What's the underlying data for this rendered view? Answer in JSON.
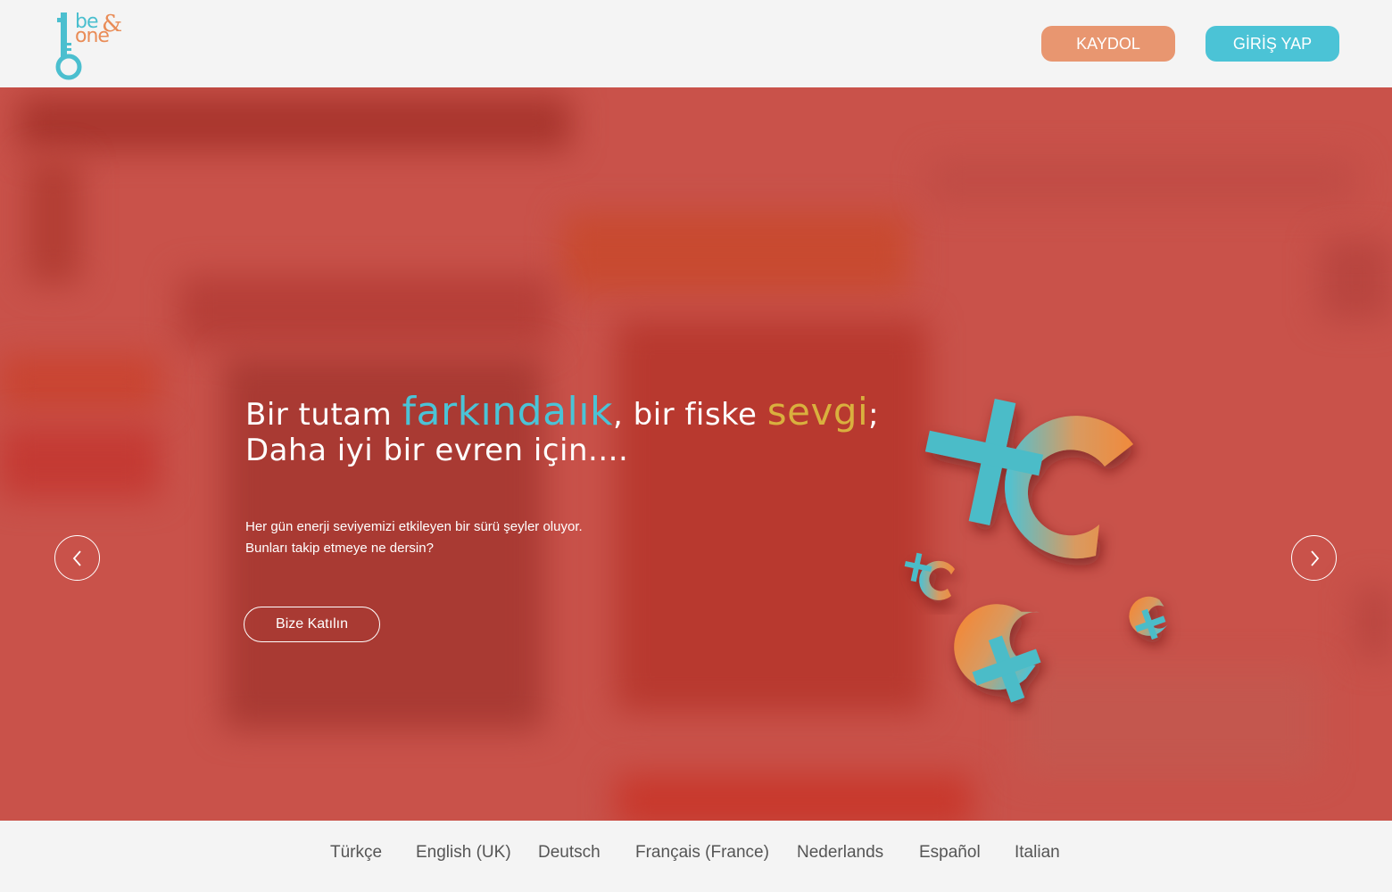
{
  "brand": {
    "logo_top": "be",
    "logo_bottom": "one",
    "logo_amp": "&"
  },
  "header": {
    "register_label": "KAYDOL",
    "login_label": "GİRİŞ YAP"
  },
  "hero": {
    "headline_part1": "Bir tutam ",
    "headline_awareness": "farkındalık",
    "headline_part2": ", bir fiske ",
    "headline_love": "sevgi",
    "headline_part3": ";",
    "headline_line2": "Daha iyi bir evren için....",
    "subtext_line1": "Her gün enerji seviyemizi etkileyen bir sürü şeyler oluyor.",
    "subtext_line2": "Bunları takip etmeye ne dersin?",
    "join_label": "Bize Katılın",
    "prev_icon": "chevron-left-icon",
    "next_icon": "chevron-right-icon"
  },
  "footer": {
    "languages": [
      "Türkçe",
      "English (UK)",
      "Deutsch",
      "Français (France)",
      "Nederlands",
      "Español",
      "Italian"
    ]
  },
  "colors": {
    "accent_teal": "#4bc3d6",
    "accent_orange": "#e89670",
    "hero_bg": "#c9524a",
    "love_yellow": "#d9b03e"
  }
}
